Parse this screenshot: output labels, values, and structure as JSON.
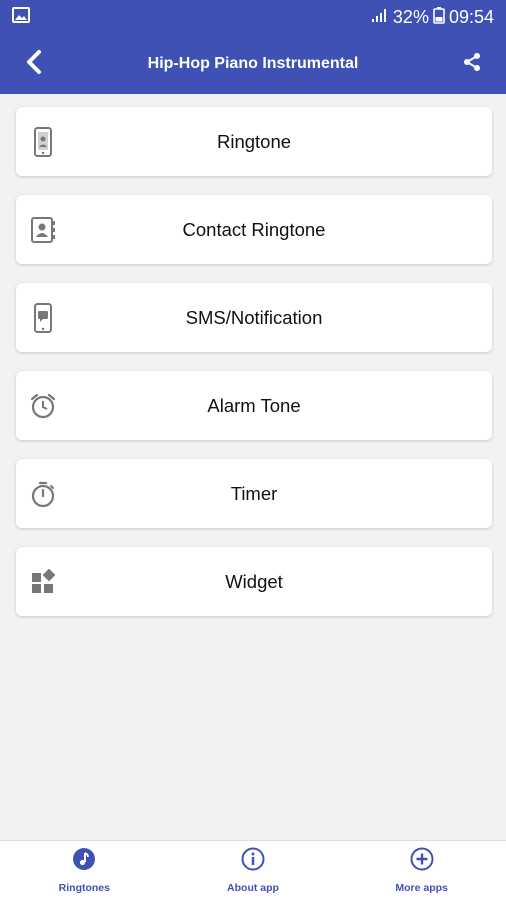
{
  "status_bar": {
    "battery": "32%",
    "time": "09:54",
    "icons": [
      "image-icon",
      "signal-icon",
      "battery-icon"
    ]
  },
  "app_bar": {
    "title": "Hip-Hop Piano Instrumental",
    "icons": [
      "back-arrow-icon",
      "share-icon"
    ]
  },
  "menu": {
    "items": [
      {
        "label": "Ringtone",
        "icon": "phone-ringtone-icon"
      },
      {
        "label": "Contact Ringtone",
        "icon": "contact-card-icon"
      },
      {
        "label": "SMS/Notification",
        "icon": "phone-message-icon"
      },
      {
        "label": "Alarm Tone",
        "icon": "alarm-clock-icon"
      },
      {
        "label": "Timer",
        "icon": "timer-icon"
      },
      {
        "label": "Widget",
        "icon": "widget-icon"
      }
    ]
  },
  "bottom_nav": {
    "items": [
      {
        "label": "Ringtones",
        "icon": "music-note-icon"
      },
      {
        "label": "About app",
        "icon": "info-icon"
      },
      {
        "label": "More apps",
        "icon": "plus-circle-icon"
      }
    ]
  },
  "colors": {
    "primary": "#3f51b5",
    "background": "#f2f2f2",
    "icon_gray": "#777777"
  }
}
